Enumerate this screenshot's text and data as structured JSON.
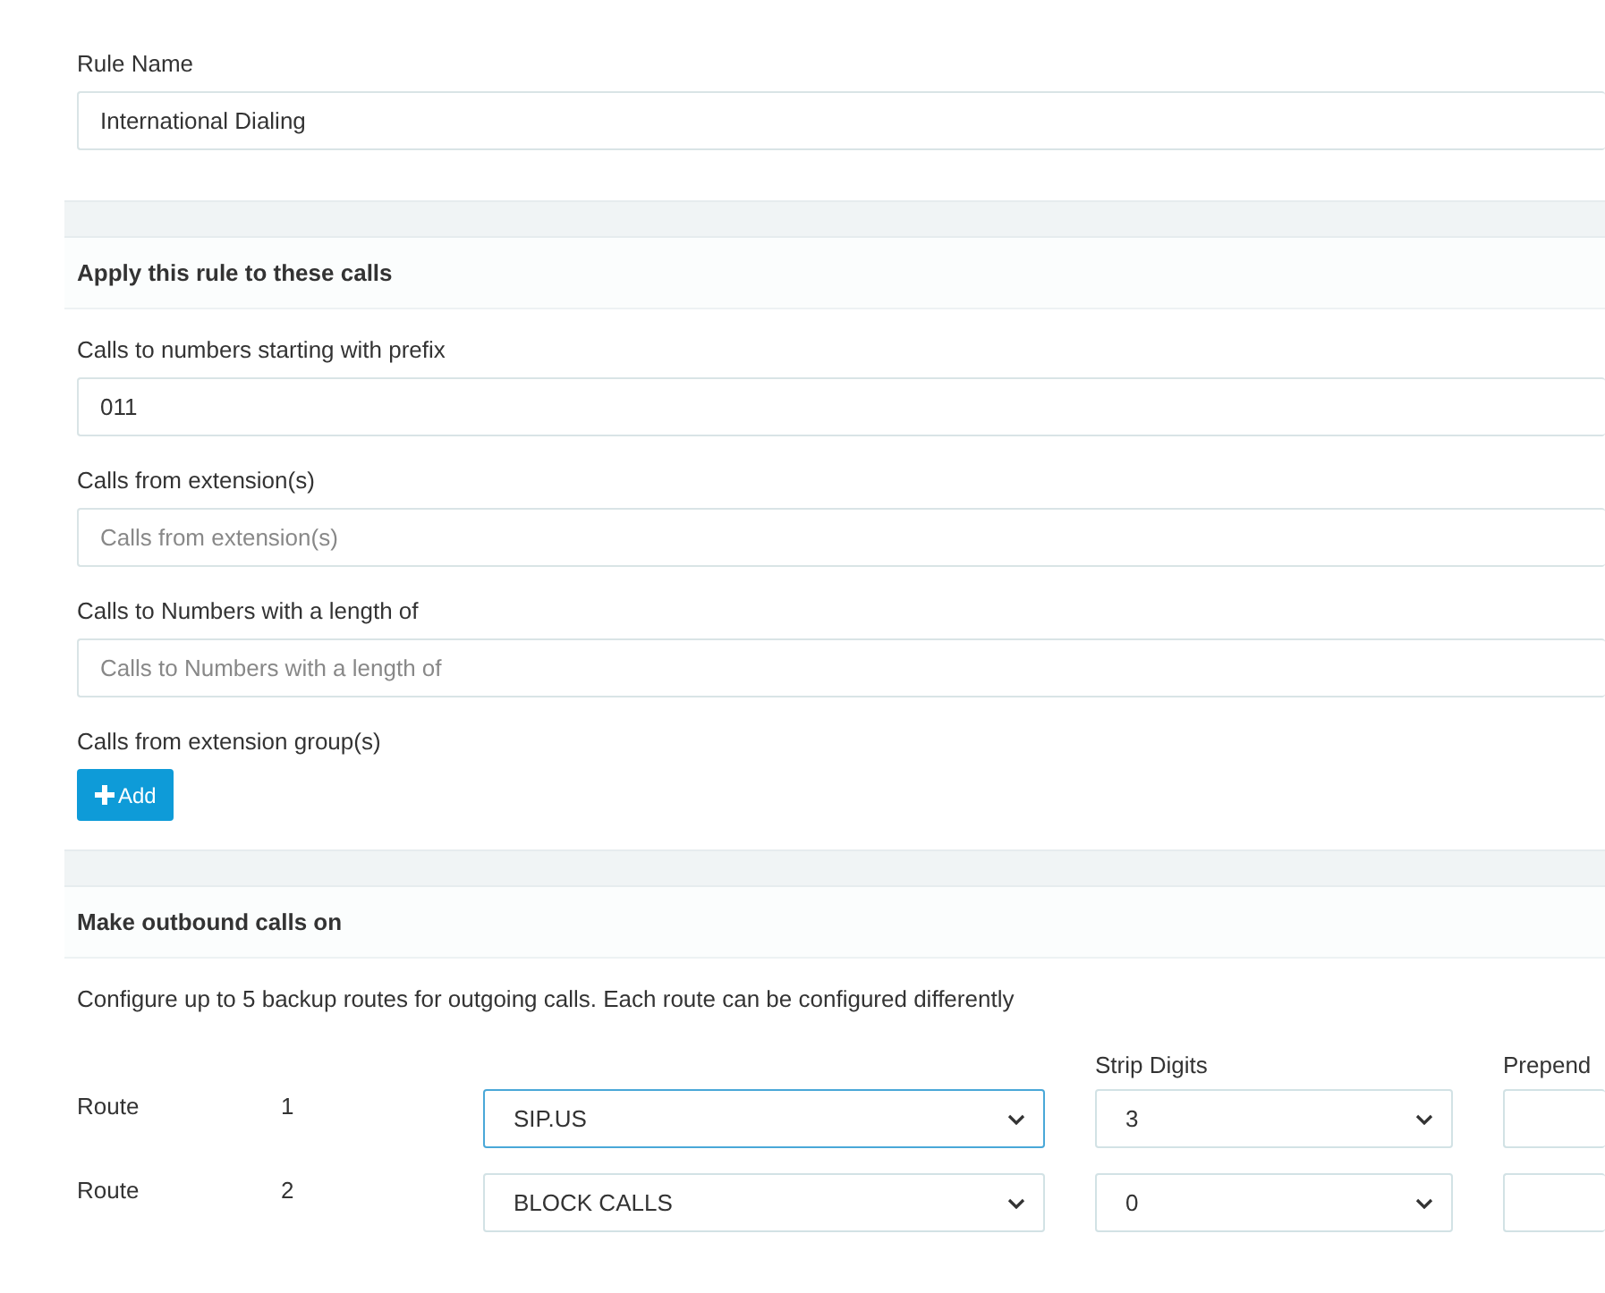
{
  "rule_name": {
    "label": "Rule Name",
    "value": "International Dialing"
  },
  "apply_section": {
    "title": "Apply this rule to these calls",
    "fields": [
      {
        "label": "Calls to numbers starting with prefix",
        "value": "011"
      },
      {
        "label": "Calls from extension(s)",
        "placeholder": "Calls from extension(s)"
      },
      {
        "label": "Calls to Numbers with a length of",
        "placeholder": "Calls to Numbers with a length of"
      }
    ],
    "group_label": "Calls from extension group(s)",
    "add_button": "Add"
  },
  "outbound_section": {
    "title": "Make outbound calls on",
    "description": "Configure up to 5 backup routes for outgoing calls. Each route can be configured differently",
    "columns": [
      "Strip Digits",
      "Prepend"
    ],
    "routes": [
      {
        "label": "Route",
        "number": "1",
        "trunk": "SIP.US",
        "strip": "3",
        "focused": true
      },
      {
        "label": "Route",
        "number": "2",
        "trunk": "BLOCK CALLS",
        "strip": "0",
        "focused": false
      }
    ]
  }
}
